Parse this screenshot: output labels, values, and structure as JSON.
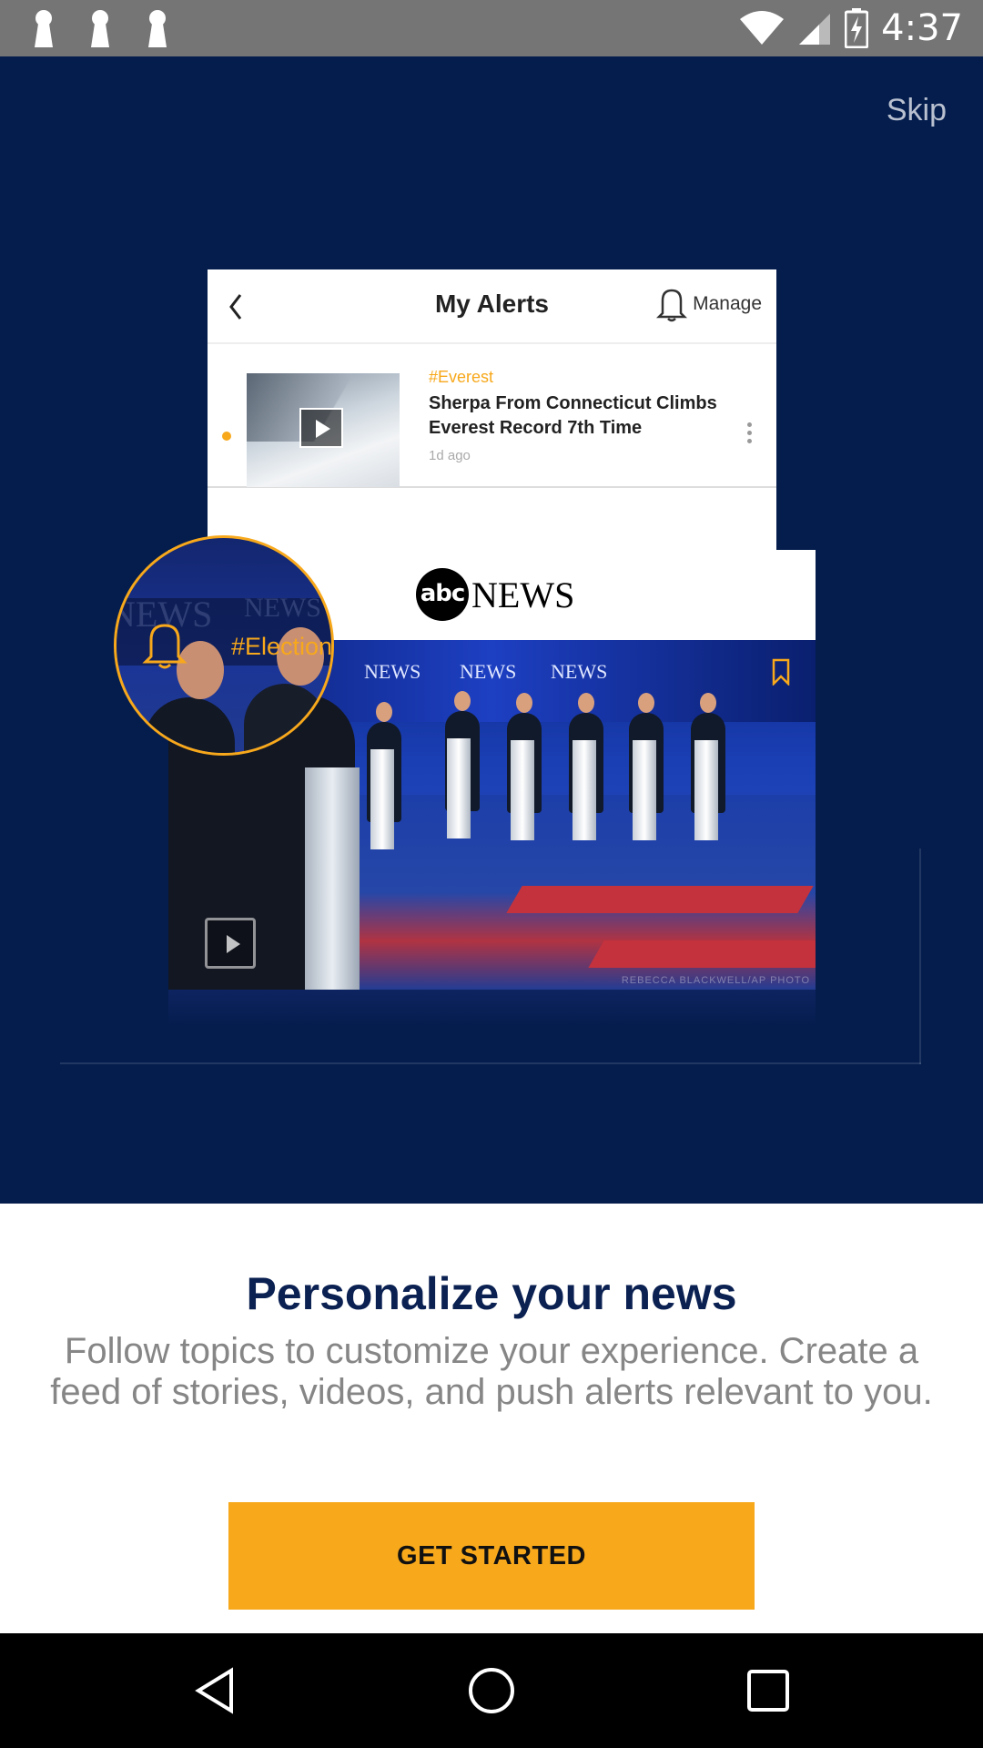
{
  "status_bar": {
    "time": "4:37",
    "notification_icons": [
      "keyhole-notification-icon",
      "keyhole-notification-icon",
      "keyhole-notification-icon"
    ],
    "icons": [
      "wifi-icon",
      "signal-icon",
      "battery-charging-icon"
    ]
  },
  "hero": {
    "skip_label": "Skip",
    "alerts_preview": {
      "title": "My Alerts",
      "manage_label": "Manage",
      "item": {
        "tag": "#Everest",
        "headline": "Sherpa From Connecticut Climbs Everest Record 7th Time",
        "time": "1d ago"
      }
    },
    "news_preview": {
      "logo_badge": "abc",
      "logo_word": "NEWS",
      "photo_credit": "REBECCA BLACKWELL/AP PHOTO",
      "backdrop_logo": "NEWS"
    },
    "magnifier": {
      "tag_text": "#Election"
    }
  },
  "panel": {
    "title": "Personalize your news",
    "body": "Follow topics to customize your experience. Create a feed of stories, videos, and push alerts relevant to you.",
    "cta_label": "GET STARTED"
  },
  "colors": {
    "hero_bg": "#041d4d",
    "accent": "#f7a81b",
    "title": "#0b2152",
    "body_text": "#868686",
    "status_bar": "#757575"
  }
}
